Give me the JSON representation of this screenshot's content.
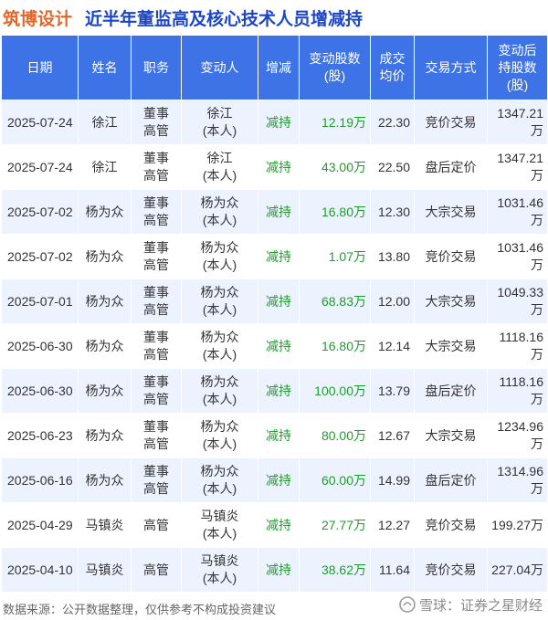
{
  "title": {
    "company": "筑博设计",
    "subject": "近半年董监高及核心技术人员增减持"
  },
  "headers": [
    [
      "日期"
    ],
    [
      "姓名"
    ],
    [
      "职务"
    ],
    [
      "变动人"
    ],
    [
      "增减"
    ],
    [
      "变动股数",
      "(股)"
    ],
    [
      "成交",
      "均价"
    ],
    [
      "交易方式"
    ],
    [
      "变动后",
      "持股数",
      "(股)"
    ]
  ],
  "rows": [
    {
      "date": "2025-07-24",
      "name": "徐江",
      "role": [
        "董事",
        "高管"
      ],
      "changer": [
        "徐江",
        "(本人)"
      ],
      "direction": "减持",
      "shares": "12.19万",
      "price": "22.30",
      "method": "竞价交易",
      "holding": "1347.21万"
    },
    {
      "date": "2025-07-24",
      "name": "徐江",
      "role": [
        "董事",
        "高管"
      ],
      "changer": [
        "徐江",
        "(本人)"
      ],
      "direction": "减持",
      "shares": "43.00万",
      "price": "22.50",
      "method": "盘后定价",
      "holding": "1347.21万"
    },
    {
      "date": "2025-07-02",
      "name": "杨为众",
      "role": [
        "董事",
        "高管"
      ],
      "changer": [
        "杨为众",
        "(本人)"
      ],
      "direction": "减持",
      "shares": "16.80万",
      "price": "12.30",
      "method": "大宗交易",
      "holding": "1031.46万"
    },
    {
      "date": "2025-07-02",
      "name": "杨为众",
      "role": [
        "董事",
        "高管"
      ],
      "changer": [
        "杨为众",
        "(本人)"
      ],
      "direction": "减持",
      "shares": "1.07万",
      "price": "13.80",
      "method": "竞价交易",
      "holding": "1031.46万"
    },
    {
      "date": "2025-07-01",
      "name": "杨为众",
      "role": [
        "董事",
        "高管"
      ],
      "changer": [
        "杨为众",
        "(本人)"
      ],
      "direction": "减持",
      "shares": "68.83万",
      "price": "12.00",
      "method": "大宗交易",
      "holding": "1049.33万"
    },
    {
      "date": "2025-06-30",
      "name": "杨为众",
      "role": [
        "董事",
        "高管"
      ],
      "changer": [
        "杨为众",
        "(本人)"
      ],
      "direction": "减持",
      "shares": "16.80万",
      "price": "12.14",
      "method": "大宗交易",
      "holding": "1118.16万"
    },
    {
      "date": "2025-06-30",
      "name": "杨为众",
      "role": [
        "董事",
        "高管"
      ],
      "changer": [
        "杨为众",
        "(本人)"
      ],
      "direction": "减持",
      "shares": "100.00万",
      "price": "13.79",
      "method": "盘后定价",
      "holding": "1118.16万"
    },
    {
      "date": "2025-06-23",
      "name": "杨为众",
      "role": [
        "董事",
        "高管"
      ],
      "changer": [
        "杨为众",
        "(本人)"
      ],
      "direction": "减持",
      "shares": "80.00万",
      "price": "12.67",
      "method": "大宗交易",
      "holding": "1234.96万"
    },
    {
      "date": "2025-06-16",
      "name": "杨为众",
      "role": [
        "董事",
        "高管"
      ],
      "changer": [
        "杨为众",
        "(本人)"
      ],
      "direction": "减持",
      "shares": "60.00万",
      "price": "14.99",
      "method": "盘后定价",
      "holding": "1314.96万"
    },
    {
      "date": "2025-04-29",
      "name": "马镇炎",
      "role": [
        "高管"
      ],
      "changer": [
        "马镇炎",
        "(本人)"
      ],
      "direction": "减持",
      "shares": "27.77万",
      "price": "12.27",
      "method": "竞价交易",
      "holding": "199.27万"
    },
    {
      "date": "2025-04-10",
      "name": "马镇炎",
      "role": [
        "高管"
      ],
      "changer": [
        "马镇炎",
        "(本人)"
      ],
      "direction": "减持",
      "shares": "38.62万",
      "price": "11.64",
      "method": "竞价交易",
      "holding": "227.04万"
    }
  ],
  "footer": {
    "source": "数据来源：公开数据整理，仅供参考不构成投资建议",
    "brand": "雪球：证券之星财经"
  },
  "colors": {
    "header_bg": "#3d73e6",
    "row_alt": "#edf3fe",
    "title_company": "#e3672a",
    "title_subject": "#1b45c8",
    "decrease_green": "#1e9e2a"
  }
}
